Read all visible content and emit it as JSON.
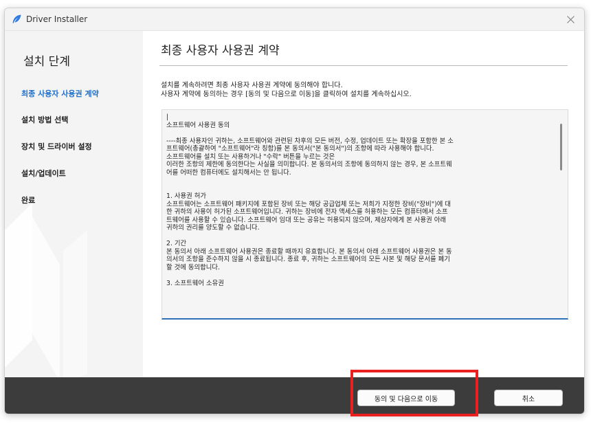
{
  "window": {
    "title": "Driver Installer",
    "icon": "feather-app-icon",
    "accent_color": "#1e6fc8"
  },
  "sidebar": {
    "title": "설치 단계",
    "steps": [
      {
        "label": "최종 사용자 사용권 계약",
        "active": true
      },
      {
        "label": "설치 방법 선택",
        "active": false
      },
      {
        "label": "장치 및 드라이버 설정",
        "active": false
      },
      {
        "label": "설치/업데이트",
        "active": false
      },
      {
        "label": "완료",
        "active": false
      }
    ]
  },
  "main": {
    "title": "최종 사용자 사용권 계약",
    "intro_line1": "설치를 계속하려면 최종 사용자 사용권 계약에 동의해야 합니다.",
    "intro_line2": "사용자 계약에 동의하는 경우 [동의 및 다음으로 이동]을 클릭하여 설치를 계속하십시오.",
    "license_text": "|\n소프트웨어 사용권 동의\n\n----최종 사용자인 귀하는, 소프트웨어와 관련된 차후의 모든 버전, 수정, 업데이트 또는 확장을 포함한 본 소\n프트웨어(총괄하여 \"소프트웨어\"라 칭함)를 본 동의서(\"본 동의서\")의 조항에 따라 사용해야 합니다.\n소프트웨어를 설치 또는 사용하거나 \"수락\" 버튼을 누르는 것은\n이러한 조항의 제한에 동의한다는 사실을 의미합니다. 본 동의서의 조항에 동의하지 않는 경우, 본 소프트웨\n어를 어떠한 컴퓨터에도 설치해서는 안 됩니다.\n\n\n1. 사용권 허가\n소프트웨어는 소프트웨어 패키지에 포함된 장비 또는 해당 공급업체 또는 저희가 지정한 장비(\"장비\")에 대\n한 귀하의 사용이 허가된 소프트웨어입니다. 귀하는 장비에 전자 액세스를 허용하는 모든 컴퓨터에서 소프\n트웨어를 사용할 수 있습니다. 소프트웨어 임대 또는 공유는 허용되지 않으며, 제삼자에게 본 사용권 아래\n귀하의 권리를 양도할 수 없습니다.\n\n2. 기간\n본 동의서 아래 소프트웨어 사용권은 종료할 때까지 유효합니다. 본 동의서 아래 소프트웨어 사용권은 본 동\n의서의 조항을 준수하지 않을 시 종료됩니다. 종료 후, 귀하는 소프트웨어의 모든 사본 및 해당 문서를 폐기\n할 것에 동의합니다.\n\n3. 소프트웨어 소유권"
  },
  "footer": {
    "agree_label": "동의 및 다음으로 이동",
    "cancel_label": "취소"
  },
  "annotation": {
    "highlight_color": "#ea1f1f"
  }
}
